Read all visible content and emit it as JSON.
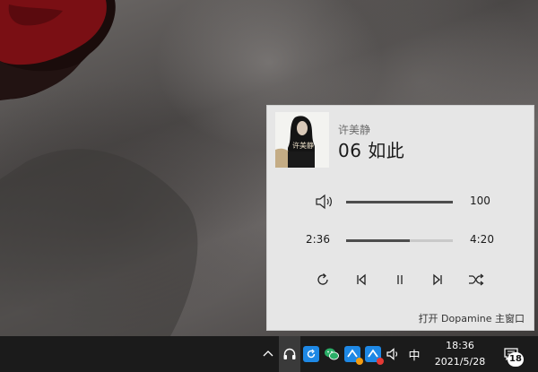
{
  "media_flyout": {
    "artist": "许美静",
    "track_title": "06 如此",
    "album_art_text": "许美静",
    "volume": {
      "value_label": "100",
      "level_fraction": 1.0
    },
    "progress": {
      "current_time": "2:36",
      "total_time": "4:20",
      "fraction": 0.6
    },
    "controls": {
      "repeat": "repeat-icon",
      "previous": "previous-icon",
      "pause": "pause-icon",
      "next": "next-icon",
      "shuffle": "shuffle-icon"
    },
    "open_main_window": "打开 Dopamine 主窗口"
  },
  "taskbar": {
    "tray_icons": [
      "chevron-up-icon",
      "headphones-icon",
      "refresh-app-icon",
      "wechat-icon",
      "lark-icon",
      "lark-icon-2",
      "speaker-icon"
    ],
    "ime_label": "中",
    "clock_time": "18:36",
    "clock_date": "2021/5/28",
    "notification_count": "18"
  },
  "colors": {
    "flyout_bg": "#e6e6e6",
    "taskbar_bg": "#1b1b1b",
    "slider_fill": "#4d4d4d",
    "wechat_green": "#2aae67",
    "app_blue": "#1e88e5"
  }
}
